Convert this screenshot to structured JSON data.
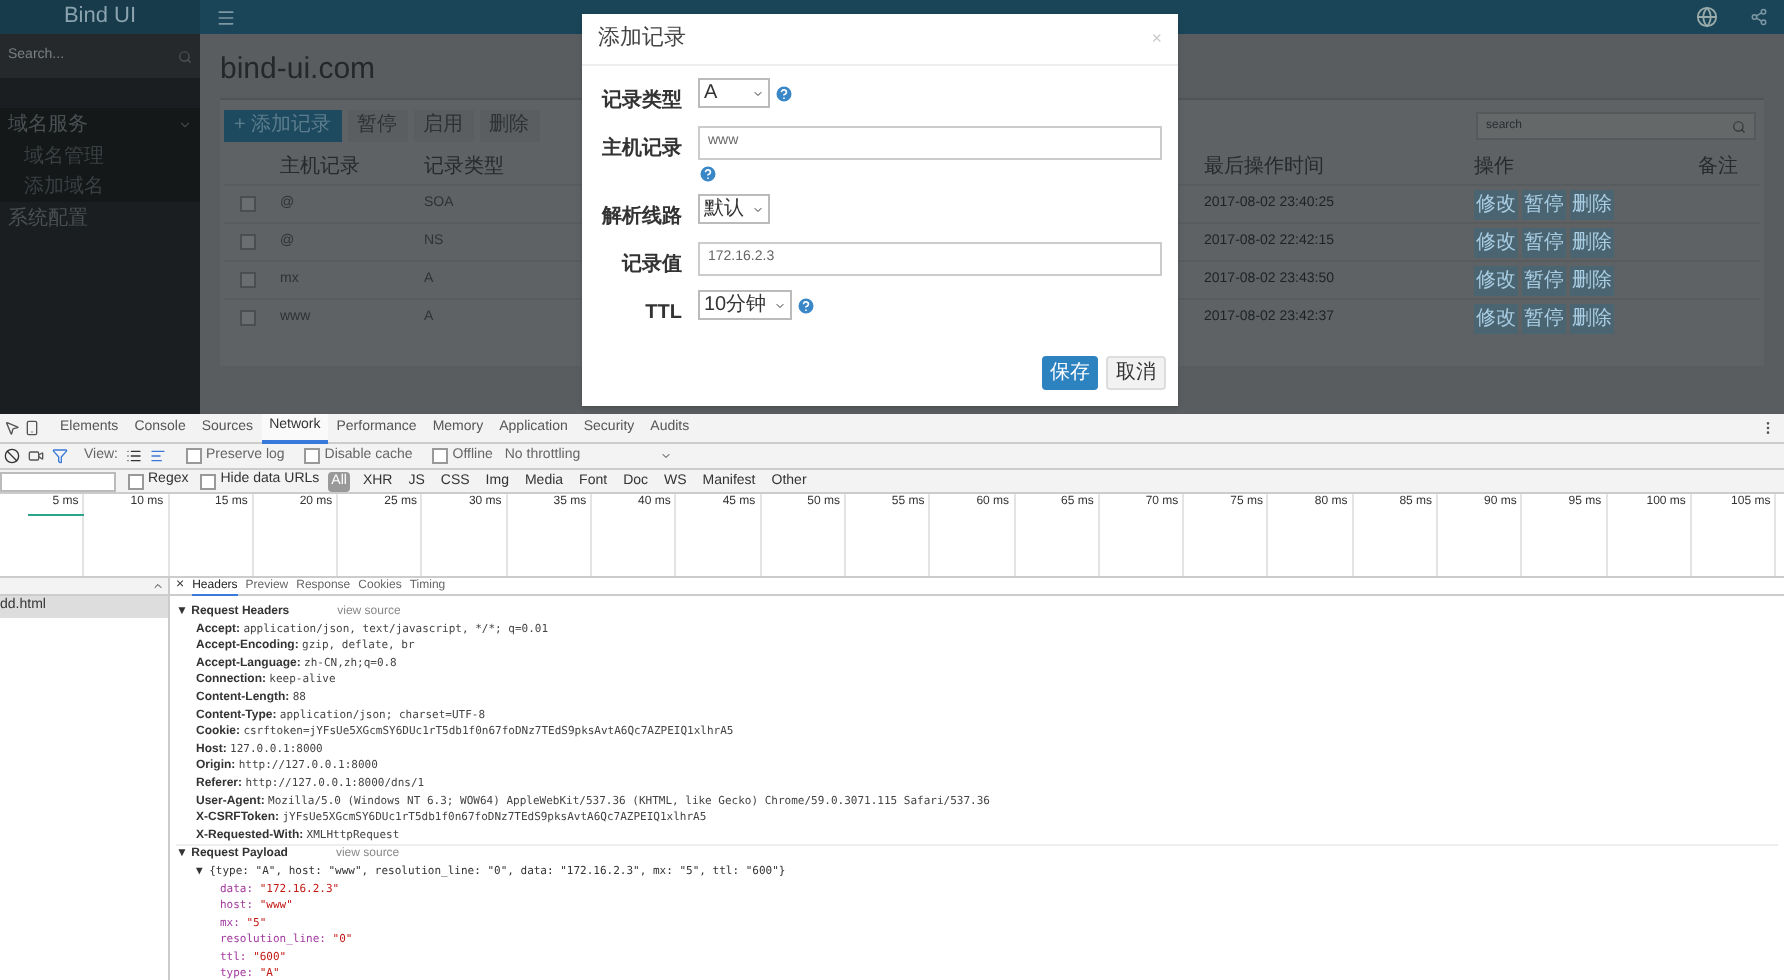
{
  "app": {
    "logo": "Bind UI",
    "sidebar": {
      "search_placeholder": "Search...",
      "items": [
        {
          "label": "域名服务",
          "expanded": true,
          "children": [
            {
              "label": "域名管理"
            },
            {
              "label": "添加域名"
            }
          ]
        },
        {
          "label": "系统配置",
          "expanded": false
        }
      ]
    },
    "page_title": "bind-ui.com",
    "toolbar": [
      {
        "label": "+ 添加记录",
        "kind": "primary"
      },
      {
        "label": "暂停",
        "kind": "default"
      },
      {
        "label": "启用",
        "kind": "default"
      },
      {
        "label": "删除",
        "kind": "default"
      }
    ],
    "search_placeholder": "search",
    "table": {
      "columns": [
        "主机记录",
        "记录类型",
        "最后操作时间",
        "操作",
        "备注"
      ],
      "rows": [
        {
          "checked": false,
          "host": "@",
          "type": "SOA",
          "time": "2017-08-02 23:40:25",
          "actions": [
            "修改",
            "暂停",
            "删除"
          ]
        },
        {
          "checked": false,
          "host": "@",
          "type": "NS",
          "time": "2017-08-02 22:42:15",
          "actions": [
            "修改",
            "暂停",
            "删除"
          ]
        },
        {
          "checked": false,
          "host": "mx",
          "type": "A",
          "time": "2017-08-02 23:43:50",
          "actions": [
            "修改",
            "暂停",
            "删除"
          ]
        },
        {
          "checked": false,
          "host": "www",
          "type": "A",
          "time": "2017-08-02 23:42:37",
          "actions": [
            "修改",
            "暂停",
            "删除"
          ]
        }
      ]
    }
  },
  "modal": {
    "title": "添加记录",
    "close": "×",
    "fields": [
      {
        "label": "记录类型",
        "kind": "select",
        "value": "A",
        "help": true
      },
      {
        "label": "主机记录",
        "kind": "input",
        "value": "www",
        "help": true,
        "help_below": true
      },
      {
        "label": "解析线路",
        "kind": "select",
        "value": "默认",
        "help": false
      },
      {
        "label": "记录值",
        "kind": "input",
        "value": "172.16.2.3",
        "help": false
      },
      {
        "label": "TTL",
        "kind": "select",
        "value": "10分钟",
        "help": true
      }
    ],
    "buttons": [
      {
        "label": "保存",
        "kind": "primary"
      },
      {
        "label": "取消",
        "kind": "default"
      }
    ]
  },
  "devtools": {
    "tabs": [
      {
        "label": "Elements",
        "selected": false
      },
      {
        "label": "Console",
        "selected": false
      },
      {
        "label": "Sources",
        "selected": false
      },
      {
        "label": "Network",
        "selected": true
      },
      {
        "label": "Performance",
        "selected": false
      },
      {
        "label": "Memory",
        "selected": false
      },
      {
        "label": "Application",
        "selected": false
      },
      {
        "label": "Security",
        "selected": false
      },
      {
        "label": "Audits",
        "selected": false
      }
    ],
    "view_label": "View:",
    "options": [
      {
        "label": "Preserve log",
        "checked": false
      },
      {
        "label": "Disable cache",
        "checked": false
      },
      {
        "label": "Offline",
        "checked": false
      }
    ],
    "throttling": "No throttling",
    "filter_options": [
      {
        "label": "Regex",
        "checked": false
      },
      {
        "label": "Hide data URLs",
        "checked": false
      }
    ],
    "types": [
      {
        "label": "All",
        "selected": true
      },
      {
        "label": "XHR",
        "selected": false
      },
      {
        "label": "JS",
        "selected": false
      },
      {
        "label": "CSS",
        "selected": false
      },
      {
        "label": "Img",
        "selected": false
      },
      {
        "label": "Media",
        "selected": false
      },
      {
        "label": "Font",
        "selected": false
      },
      {
        "label": "Doc",
        "selected": false
      },
      {
        "label": "WS",
        "selected": false
      },
      {
        "label": "Manifest",
        "selected": false
      },
      {
        "label": "Other",
        "selected": false
      }
    ],
    "timeline_ticks": [
      "5 ms",
      "10 ms",
      "15 ms",
      "20 ms",
      "25 ms",
      "30 ms",
      "35 ms",
      "40 ms",
      "45 ms",
      "50 ms",
      "55 ms",
      "60 ms",
      "65 ms",
      "70 ms",
      "75 ms",
      "80 ms",
      "85 ms",
      "90 ms",
      "95 ms",
      "100 ms",
      "105 ms"
    ],
    "requests": [
      {
        "name": "dd.html",
        "selected": true
      }
    ],
    "detail_close": "×",
    "detail_tabs": [
      {
        "label": "Headers",
        "selected": true
      },
      {
        "label": "Preview",
        "selected": false
      },
      {
        "label": "Response",
        "selected": false
      },
      {
        "label": "Cookies",
        "selected": false
      },
      {
        "label": "Timing",
        "selected": false
      }
    ],
    "sections": [
      {
        "toggle": "▼",
        "title": "Request Headers",
        "expanded": true,
        "link": "view source",
        "lines": [
          {
            "name": "Accept:",
            "value": "application/json, text/javascript, */*; q=0.01"
          },
          {
            "name": "Accept-Encoding:",
            "value": "gzip, deflate, br"
          },
          {
            "name": "Accept-Language:",
            "value": "zh-CN,zh;q=0.8"
          },
          {
            "name": "Connection:",
            "value": "keep-alive"
          },
          {
            "name": "Content-Length:",
            "value": "88"
          },
          {
            "name": "Content-Type:",
            "value": "application/json; charset=UTF-8"
          },
          {
            "name": "Cookie:",
            "value": "csrftoken=jYFsUe5XGcmSY6DUc1rT5db1f0n67foDNz7TEdS9pksAvtA6Qc7AZPEIQ1xlhrA5"
          },
          {
            "name": "Host:",
            "value": "127.0.0.1:8000"
          },
          {
            "name": "Origin:",
            "value": "http://127.0.0.1:8000"
          },
          {
            "name": "Referer:",
            "value": "http://127.0.0.1:8000/dns/1"
          },
          {
            "name": "User-Agent:",
            "value": "Mozilla/5.0 (Windows NT 6.3; WOW64) AppleWebKit/537.36 (KHTML, like Gecko) Chrome/59.0.3071.115 Safari/537.36"
          },
          {
            "name": "X-CSRFToken:",
            "value": "jYFsUe5XGcmSY6DUc1rT5db1f0n67foDNz7TEdS9pksAvtA6Qc7AZPEIQ1xlhrA5"
          },
          {
            "name": "X-Requested-With:",
            "value": "XMLHttpRequest"
          }
        ]
      },
      {
        "toggle": "▼",
        "title": "Request Payload",
        "expanded": true,
        "link": "view source",
        "summary_toggle": "▼",
        "summary": "{type: \"A\", host: \"www\", resolution_line: \"0\", data: \"172.16.2.3\", mx: \"5\", ttl: \"600\"}",
        "props": [
          {
            "name": "data:",
            "value": "\"172.16.2.3\""
          },
          {
            "name": "host:",
            "value": "\"www\""
          },
          {
            "name": "mx:",
            "value": "\"5\""
          },
          {
            "name": "resolution_line:",
            "value": "\"0\""
          },
          {
            "name": "ttl:",
            "value": "\"600\""
          },
          {
            "name": "type:",
            "value": "\"A\""
          }
        ]
      }
    ]
  }
}
